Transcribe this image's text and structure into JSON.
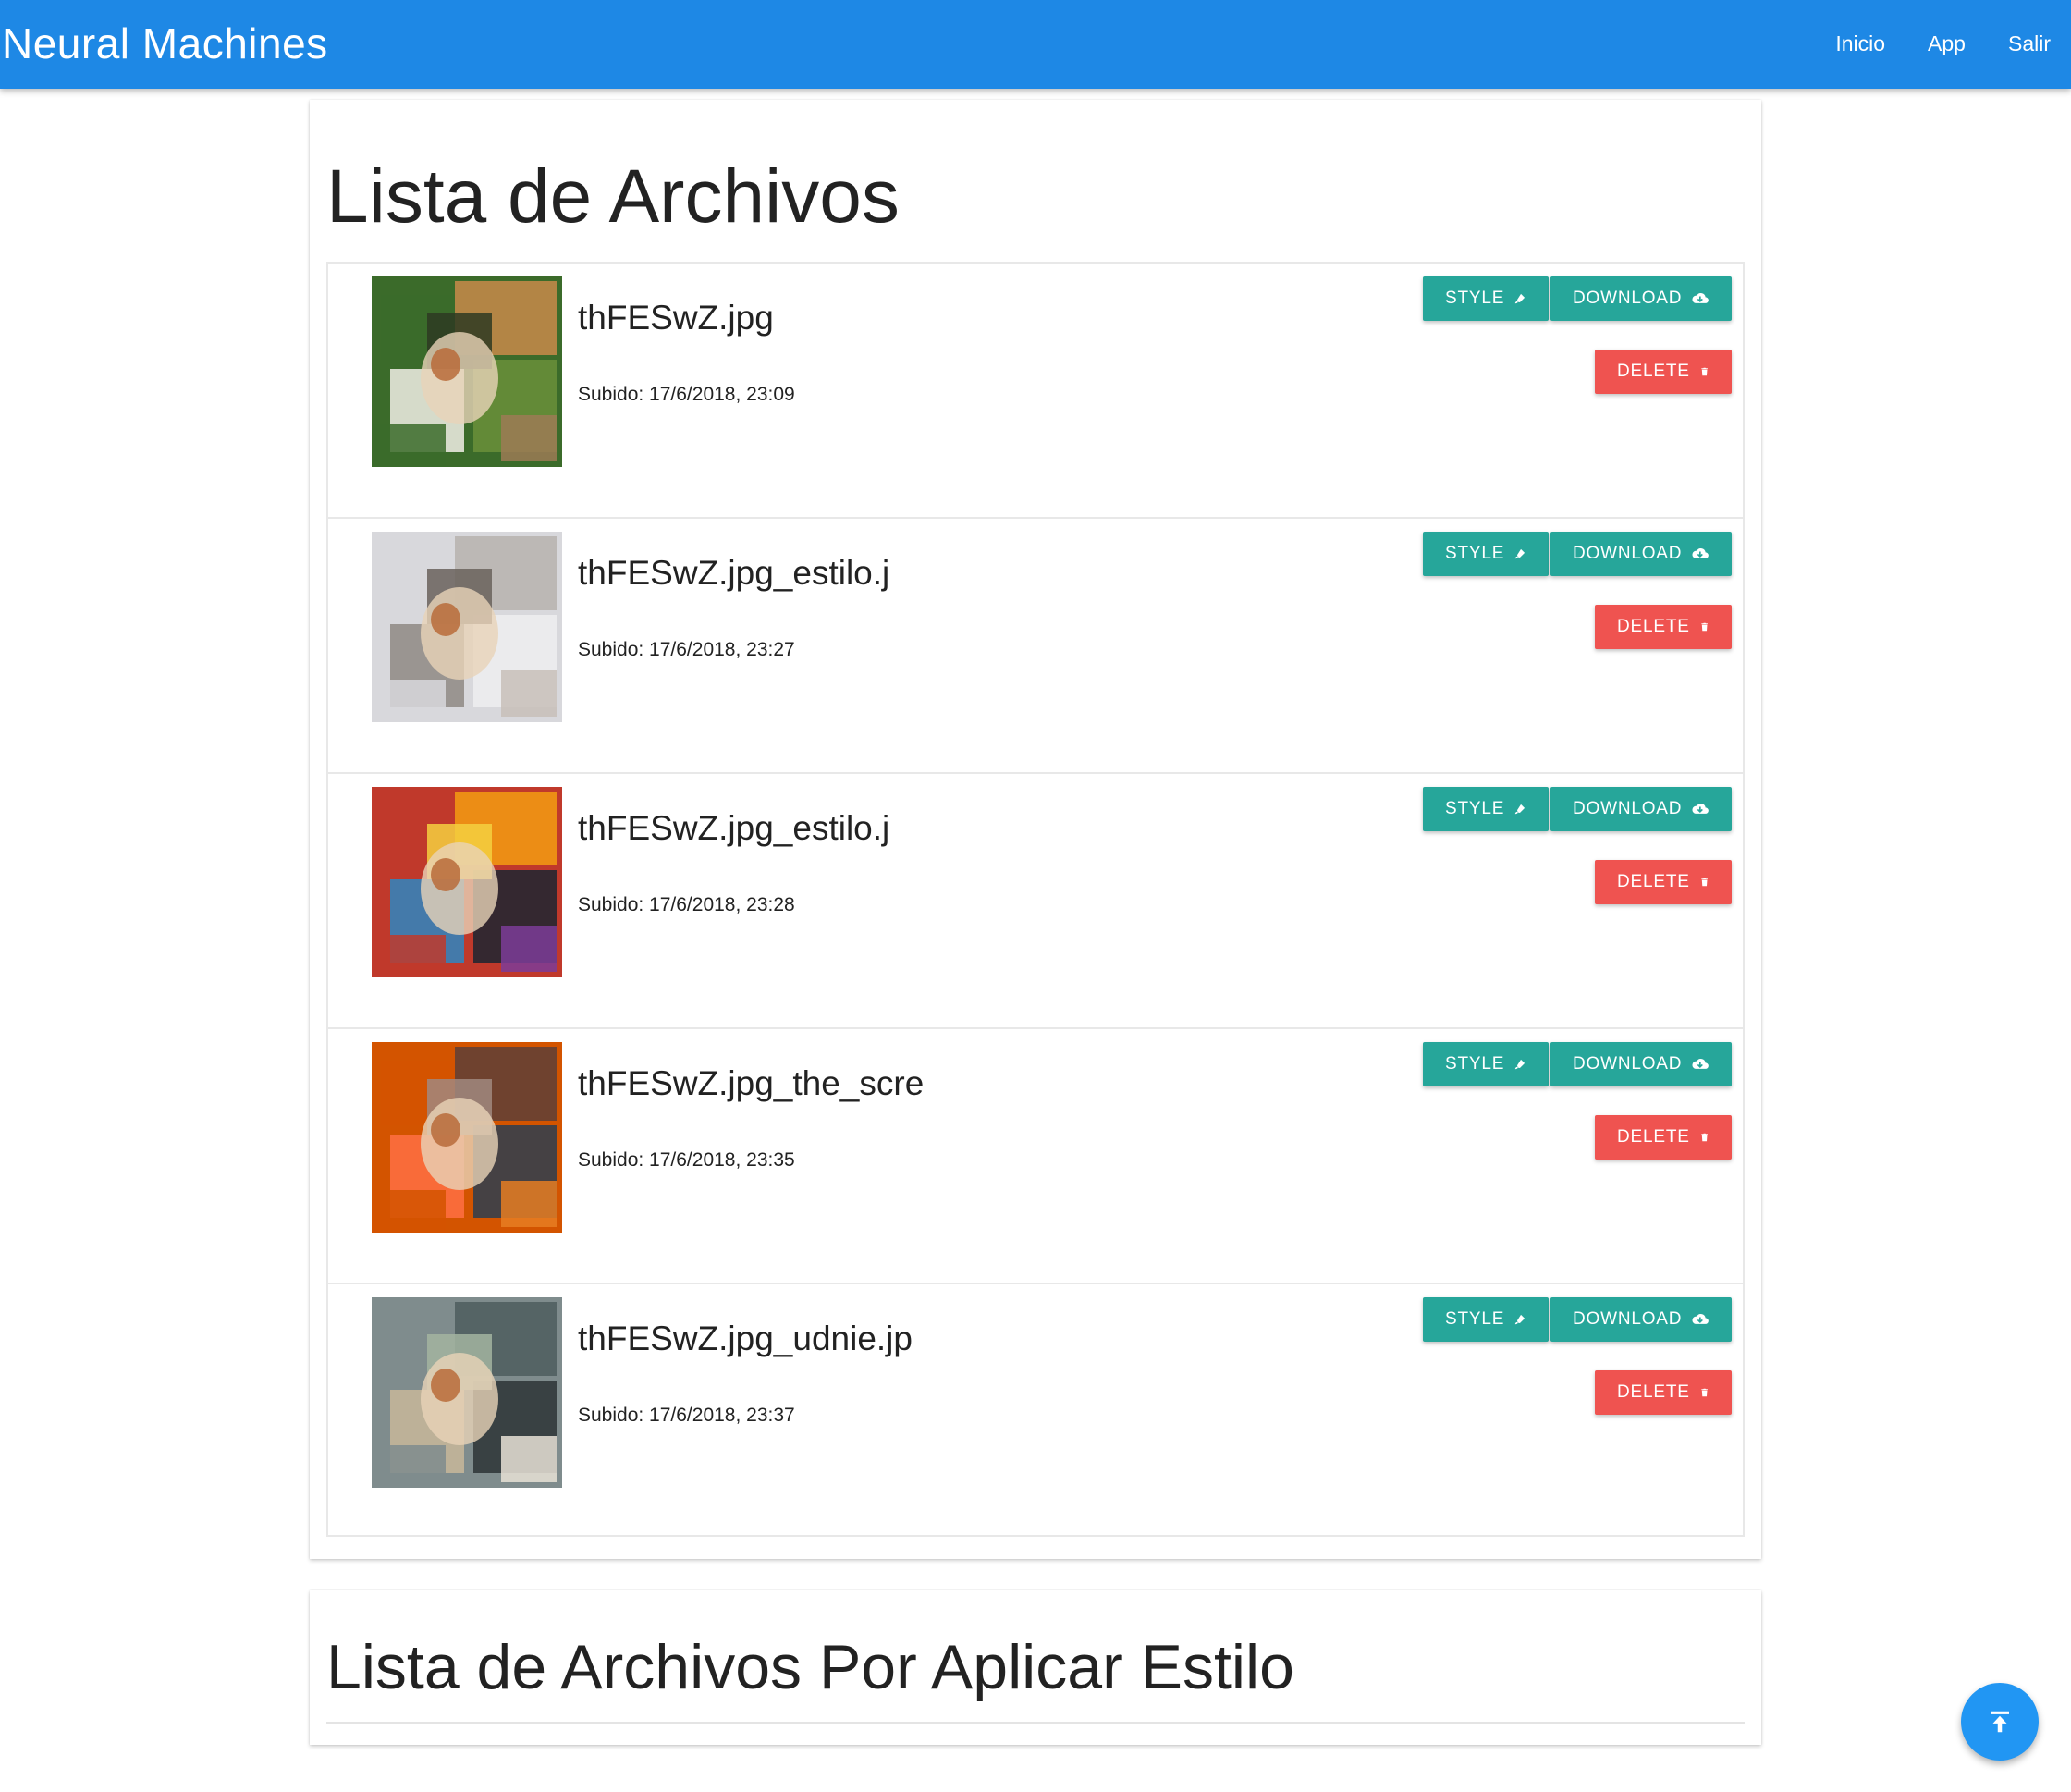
{
  "navbar": {
    "brand": "Neural Machines",
    "links": [
      "Inicio",
      "App",
      "Salir"
    ]
  },
  "files_section": {
    "title": "Lista de Archivos",
    "items": [
      {
        "name": "thFESwZ.jpg",
        "uploaded": "Subido: 17/6/2018, 23:09"
      },
      {
        "name": "thFESwZ.jpg_estilo.j",
        "uploaded": "Subido: 17/6/2018, 23:27"
      },
      {
        "name": "thFESwZ.jpg_estilo.j",
        "uploaded": "Subido: 17/6/2018, 23:28"
      },
      {
        "name": "thFESwZ.jpg_the_scre",
        "uploaded": "Subido: 17/6/2018, 23:35"
      },
      {
        "name": "thFESwZ.jpg_udnie.jp",
        "uploaded": "Subido: 17/6/2018, 23:37"
      }
    ],
    "buttons": {
      "style": "STYLE",
      "download": "DOWNLOAD",
      "delete": "DELETE"
    }
  },
  "pending_section": {
    "title": "Lista de Archivos Por Aplicar Estilo"
  },
  "icons": {
    "style": "brush-icon",
    "download": "cloud-download-icon",
    "delete": "trash-icon",
    "scroll_top": "vertical-align-top-icon"
  },
  "colors": {
    "navbar": "#1e88e5",
    "teal_button": "#26a69a",
    "red_button": "#ef5350",
    "fab": "#2196f3"
  }
}
